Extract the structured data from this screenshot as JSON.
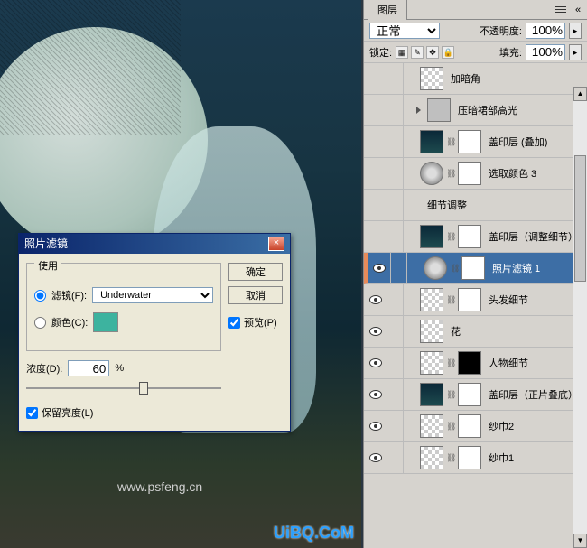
{
  "canvas": {
    "watermark": "www.psfeng.cn",
    "watermark2": "UiBQ.CoM"
  },
  "dialog": {
    "title": "照片滤镜",
    "fieldset_label": "使用",
    "filter_radio_label": "滤镜(F):",
    "filter_value": "Underwater",
    "color_radio_label": "颜色(C):",
    "color_swatch": "#3db39f",
    "density_label": "浓度(D):",
    "density_value": "60",
    "density_unit": "%",
    "preserve_label": "保留亮度(L)",
    "ok_label": "确定",
    "cancel_label": "取消",
    "preview_label": "预览(P)"
  },
  "panel": {
    "tab_label": "图层",
    "blend_mode": "正常",
    "opacity_label": "不透明度:",
    "opacity_value": "100%",
    "lock_label": "锁定:",
    "fill_label": "填充:",
    "fill_value": "100%"
  },
  "layers": [
    {
      "visible": false,
      "thumbs": [
        "checker"
      ],
      "name": "加暗角",
      "indent": 1
    },
    {
      "visible": false,
      "thumbs": [
        "folder"
      ],
      "name": "压暗裙部高光",
      "group": true,
      "indent": 1
    },
    {
      "visible": false,
      "thumbs": [
        "dark",
        "mask"
      ],
      "name": "盖印层 (叠加)",
      "chain": true,
      "indent": 1
    },
    {
      "visible": false,
      "thumbs": [
        "adj",
        "mask"
      ],
      "name": "选取颜色 3",
      "chain": true,
      "indent": 1
    },
    {
      "visible": false,
      "thumbs": [],
      "name": "细节调整",
      "indent": 1
    },
    {
      "visible": false,
      "thumbs": [
        "dark",
        "mask"
      ],
      "name": "盖印层（调整细节）",
      "chain": true,
      "indent": 1
    },
    {
      "visible": true,
      "thumbs": [
        "adj",
        "mask"
      ],
      "name": "照片滤镜 1",
      "chain": true,
      "indent": 1,
      "selected": true
    },
    {
      "visible": true,
      "thumbs": [
        "checker",
        "mask"
      ],
      "name": "头发细节",
      "chain": true,
      "indent": 1
    },
    {
      "visible": true,
      "thumbs": [
        "checker"
      ],
      "name": "花",
      "indent": 1
    },
    {
      "visible": true,
      "thumbs": [
        "checker",
        "mask-black"
      ],
      "name": "人物细节",
      "chain": true,
      "indent": 1
    },
    {
      "visible": true,
      "thumbs": [
        "dark",
        "mask"
      ],
      "name": "盖印层（正片叠底）",
      "chain": true,
      "indent": 1
    },
    {
      "visible": true,
      "thumbs": [
        "checker",
        "mask"
      ],
      "name": "纱巾2",
      "chain": true,
      "indent": 1
    },
    {
      "visible": true,
      "thumbs": [
        "checker",
        "mask"
      ],
      "name": "纱巾1",
      "chain": true,
      "indent": 1
    }
  ]
}
